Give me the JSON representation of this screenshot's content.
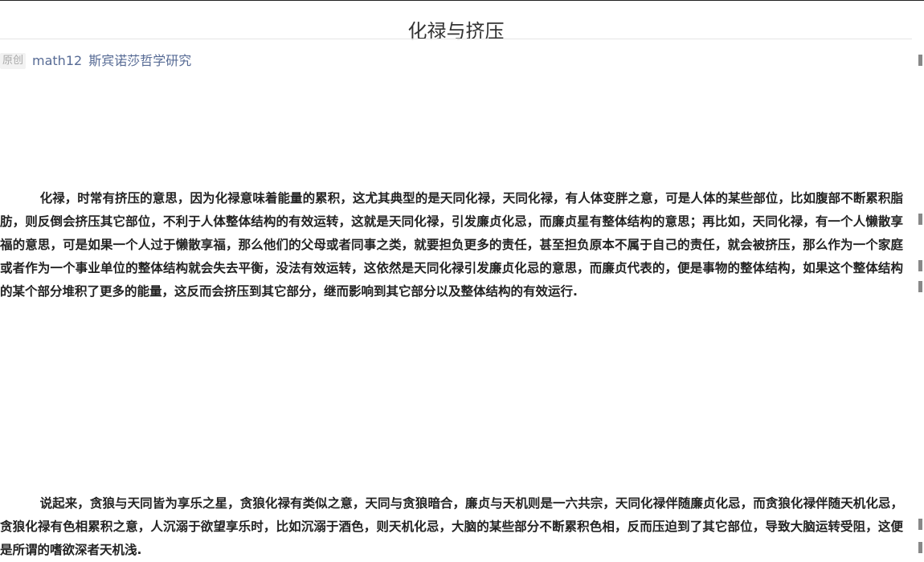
{
  "article": {
    "title": "化禄与挤压",
    "meta": {
      "badge": "原创",
      "author": "math12",
      "account": "斯宾诺莎哲学研究"
    },
    "paragraphs": [
      "化禄，时常有挤压的意思，因为化禄意味着能量的累积，这尤其典型的是天同化禄，天同化禄，有人体变胖之意，可是人体的某些部位，比如腹部不断累积脂肪，则反倒会挤压其它部位，不利于人体整体结构的有效运转，这就是天同化禄，引发廉贞化忌，而廉贞星有整体结构的意思；再比如，天同化禄，有一个人懒散享福的意思，可是如果一个人过于懒散享福，那么他们的父母或者同事之类，就要担负更多的责任，甚至担负原本不属于自己的责任，就会被挤压，那么作为一个家庭或者作为一个事业单位的整体结构就会失去平衡，没法有效运转，这依然是天同化禄引发廉贞化忌的意思，而廉贞代表的，便是事物的整体结构，如果这个整体结构的某个部分堆积了更多的能量，这反而会挤压到其它部分，继而影响到其它部分以及整体结构的有效运行.",
      "说起来，贪狼与天同皆为享乐之星，贪狼化禄有类似之意，天同与贪狼暗合，廉贞与天机则是一六共宗，天同化禄伴随廉贞化忌，而贪狼化禄伴随天机化忌，贪狼化禄有色相累积之意，人沉溺于欲望享乐时，比如沉溺于酒色，则天机化忌，大脑的某些部分不断累积色相，反而压迫到了其它部位，导致大脑运转受阻，这便是所谓的嗜欲深者天机浅."
    ]
  }
}
